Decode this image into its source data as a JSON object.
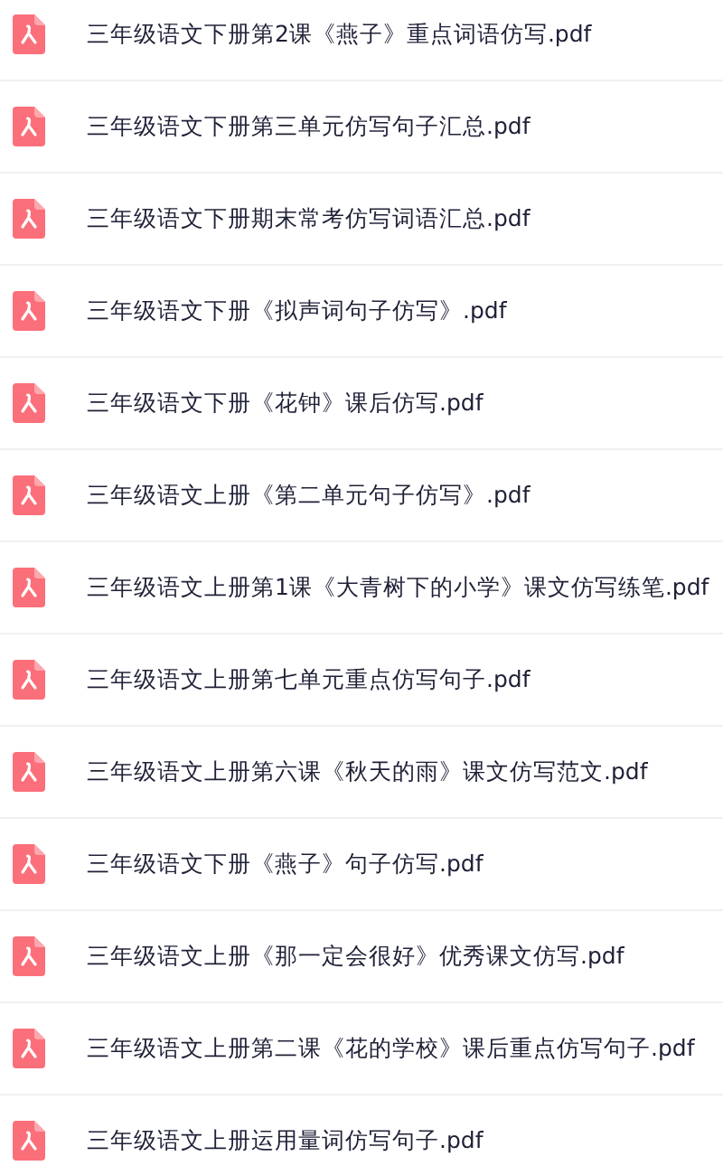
{
  "files": [
    {
      "name": "三年级语文下册第2课《燕子》重点词语仿写.pdf"
    },
    {
      "name": "三年级语文下册第三单元仿写句子汇总.pdf"
    },
    {
      "name": "三年级语文下册期末常考仿写词语汇总.pdf"
    },
    {
      "name": "三年级语文下册《拟声词句子仿写》.pdf"
    },
    {
      "name": "三年级语文下册《花钟》课后仿写.pdf"
    },
    {
      "name": "三年级语文上册《第二单元句子仿写》.pdf"
    },
    {
      "name": "三年级语文上册第1课《大青树下的小学》课文仿写练笔.pdf"
    },
    {
      "name": "三年级语文上册第七单元重点仿写句子.pdf"
    },
    {
      "name": "三年级语文上册第六课《秋天的雨》课文仿写范文.pdf"
    },
    {
      "name": "三年级语文下册《燕子》句子仿写.pdf"
    },
    {
      "name": "三年级语文上册《那一定会很好》优秀课文仿写.pdf"
    },
    {
      "name": "三年级语文上册第二课《花的学校》课后重点仿写句子.pdf"
    },
    {
      "name": "三年级语文上册运用量词仿写句子.pdf"
    }
  ]
}
